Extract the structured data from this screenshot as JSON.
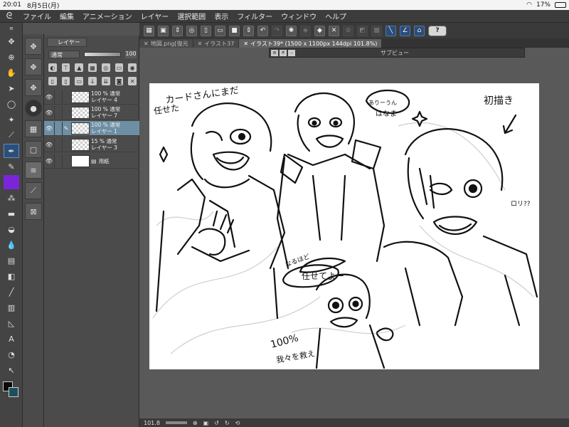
{
  "status_bar": {
    "time": "20:01",
    "date": "8月5日(月)",
    "battery": "17%"
  },
  "menu": {
    "items": [
      "ファイル",
      "編集",
      "アニメーション",
      "レイヤー",
      "選択範囲",
      "表示",
      "フィルター",
      "ウィンドウ",
      "ヘルプ"
    ]
  },
  "layer_panel": {
    "tab_label": "レイヤー",
    "blend_mode": "通常",
    "opacity": "100",
    "layers": [
      {
        "line1": "100 % 通常",
        "line2": "レイヤー 4"
      },
      {
        "line1": "100 % 通常",
        "line2": "レイヤー 7"
      },
      {
        "line1": "100 % 通常",
        "line2": "レイヤー 1"
      },
      {
        "line1": "15 % 通常",
        "line2": "レイヤー 3"
      },
      {
        "line1": "",
        "line2": "用紙"
      }
    ]
  },
  "tabs": [
    {
      "label": "地図.png[復元"
    },
    {
      "label": "イラスト37"
    },
    {
      "label": "イラスト39* (1500 x 1100px 144dpi 101.8%)"
    }
  ],
  "subview": {
    "title": "サブビュー"
  },
  "bottom": {
    "zoom": "101.8"
  },
  "canvas_text": {
    "t1": "カードさんにまだ",
    "t2": "任せた",
    "t3": "ありーうん",
    "t4": "はなま",
    "t5": "初描き",
    "t6": "ロリ??",
    "t7": "なるほど",
    "t8": "任せてよー",
    "t9": "100%",
    "t10": "我々を救え"
  },
  "colors": {
    "accent": "#2d4e78",
    "active_layer": "#6e8ea3",
    "purple_tool": "#7a26d8",
    "foreground": "#0a0a0a",
    "background": "#1d4e5c"
  }
}
